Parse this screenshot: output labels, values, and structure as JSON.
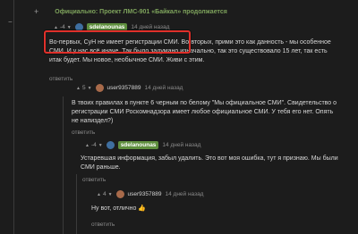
{
  "topbar": {
    "plus": "+",
    "minus": "−",
    "title": "Официально: Проект ЛМС-901 «Байкал» продолжается"
  },
  "comment1": {
    "score": "-4",
    "username": "sdelanounas",
    "date": "14 дней назад",
    "line1": "Во-первых, СуН не имеет регистрации СМИ. Во-вторых, прими это как данность - мы особенное",
    "line2": "СМИ. И у нас всё иначе. Так было задумано изначально, так это существовало 15 лет, так есть",
    "line3": "итак будет. Мы новое, необычное СМИ. Живи с этим.",
    "reply": "ответить"
  },
  "comment2": {
    "score": "5",
    "username": "user9357889",
    "date": "14 дней назад",
    "line1": "В твоих правилах в пункте 6 черным по белому \"Мы официальное СМИ\". Свидетельство о",
    "line2": "регистрации СМИ Роскомнадзора имеет любое официальное СМИ. У тебя его нет. Опять",
    "line3": "не напиздел?)",
    "reply": "ответить"
  },
  "comment3": {
    "score": "-4",
    "username": "sdelanounas",
    "date": "14 дней назад",
    "line1": "Устаревшая информация, забыл удалить. Это вот моя ошибка, тут я признаю. Мы были",
    "line2": "СМИ раньше.",
    "reply": "ответить"
  },
  "comment4": {
    "score": "4",
    "username": "user9357889",
    "date": "14 дней назад",
    "line1": "Ну вот, отлично 👍",
    "reply": "ответить"
  },
  "colors": {
    "accent_green": "#5f8f3e",
    "highlight": "#e0302a",
    "background": "#1c1c1c"
  }
}
